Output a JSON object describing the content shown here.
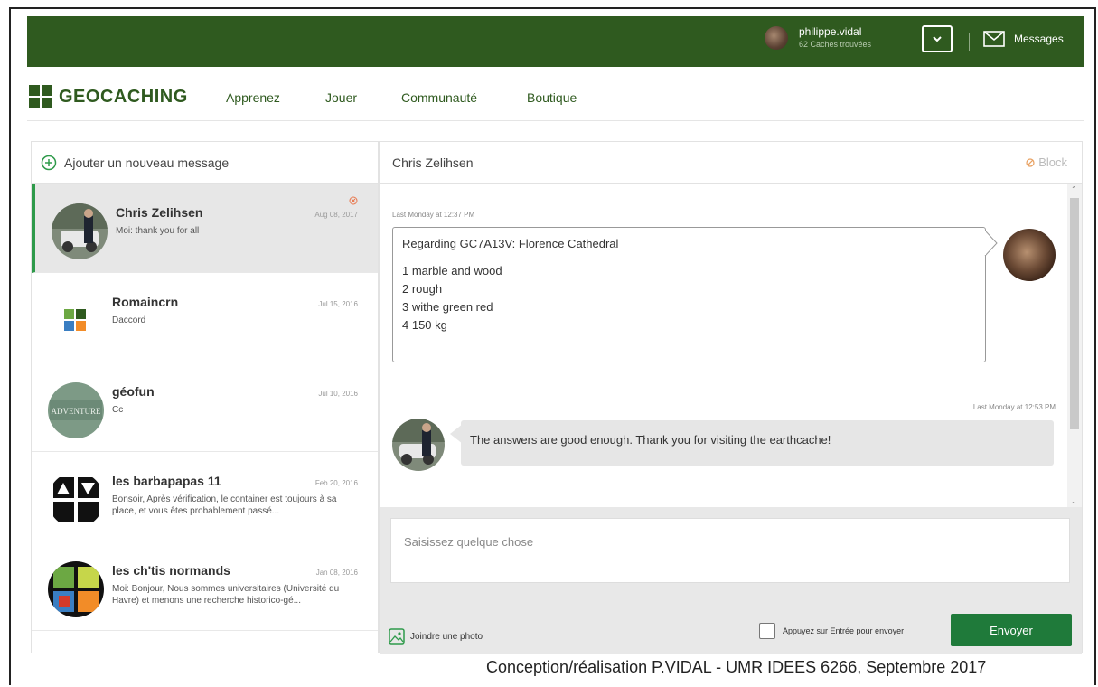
{
  "header": {
    "username": "philippe.vidal",
    "caches_found": "62 Caches trouvées",
    "messages_label": "Messages"
  },
  "nav": {
    "logo_text": "GEOCACHING",
    "items": [
      {
        "label": "Apprenez"
      },
      {
        "label": "Jouer"
      },
      {
        "label": "Communauté"
      },
      {
        "label": "Boutique"
      }
    ]
  },
  "sidebar": {
    "new_message_label": "Ajouter un nouveau message",
    "conversations": [
      {
        "name": "Chris Zelihsen",
        "date": "Aug 08, 2017",
        "preview": "Moi: thank you for all",
        "active": true,
        "avatar": "person-photo"
      },
      {
        "name": "Romaincrn",
        "date": "Jul 15, 2016",
        "preview": "Daccord",
        "active": false,
        "avatar": "geocaching-logo"
      },
      {
        "name": "géofun",
        "date": "Jul 10, 2016",
        "preview": "Cc",
        "active": false,
        "avatar": "adventure-sign"
      },
      {
        "name": "les barbapapas 11",
        "date": "Feb 20, 2016",
        "preview": "Bonsoir, Après vérification, le container est toujours à sa place, et vous êtes probablement passé...",
        "active": false,
        "avatar": "bw-logo"
      },
      {
        "name": "les ch'tis normands",
        "date": "Jan 08, 2016",
        "preview": "Moi: Bonjour, Nous sommes universitaires (Université du Havre) et menons une recherche historico-gé...",
        "active": false,
        "avatar": "colorful-logo"
      }
    ]
  },
  "thread": {
    "title": "Chris Zelihsen",
    "block_label": "Block",
    "messages": [
      {
        "timestamp": "Last Monday at 12:37 PM",
        "lines": [
          "Regarding GC7A13V: Florence Cathedral",
          "",
          "1 marble and wood",
          "2 rough",
          "3 withe green red",
          "4 150 kg"
        ]
      },
      {
        "timestamp": "Last Monday at 12:53 PM",
        "text": "The answers are good enough. Thank you for visiting the earthcache!"
      }
    ]
  },
  "compose": {
    "placeholder": "Saisissez quelque chose",
    "attach_label": "Joindre une photo",
    "enter_label": "Appuyez sur Entrée pour envoyer",
    "send_label": "Envoyer"
  },
  "footer": {
    "credit": "Conception/réalisation P.VIDAL - UMR IDEES 6266, Septembre 2017"
  },
  "colors": {
    "header_green": "#2f5a1f",
    "active_accent": "#2e9a4a",
    "send_button": "#1f7a3a"
  }
}
